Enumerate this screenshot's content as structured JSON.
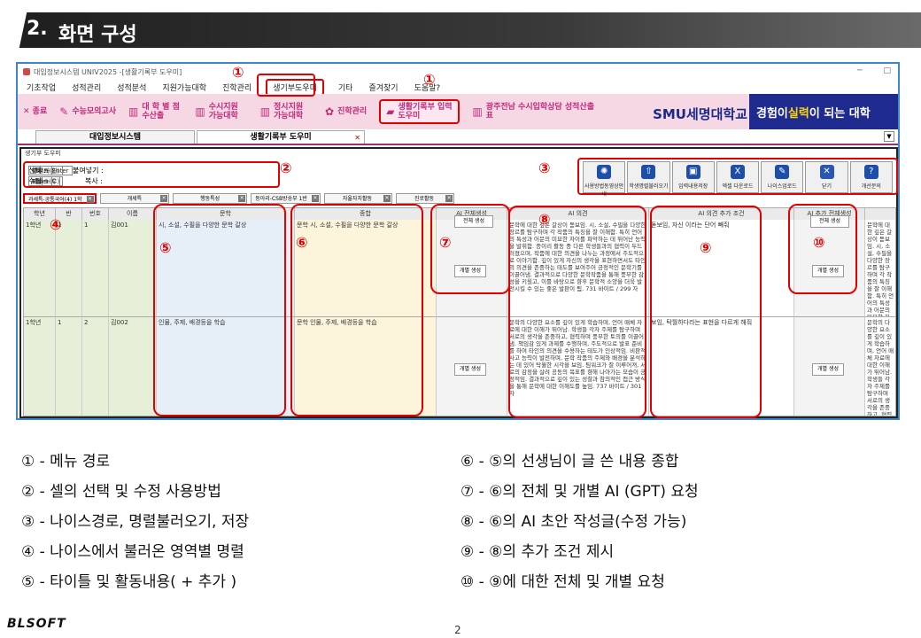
{
  "slide": {
    "number": "2.",
    "title": "화면 구성",
    "page": "2",
    "logo": "BLSOFT"
  },
  "window": {
    "title": "대입정보시스템 UNIV2025 -[생활기록부 도우미]",
    "min": "─",
    "max": "□"
  },
  "menu": [
    "기초작업",
    "성적관리",
    "성적분석",
    "지원가능대학",
    "진학관리",
    "생기부도우미",
    "기타",
    "즐겨찾기",
    "도움말?"
  ],
  "toolbar": {
    "items": [
      "✕ 종료",
      "수능모의고사",
      "대 학 별 점수산출",
      "수시지원 가능대학",
      "정시지원 가능대학",
      "진학관리"
    ],
    "highlight": "생활기록부 입력도우미",
    "extra": "광주전남 수시입학상담 성적산출표",
    "brand": "SMU세명대학교",
    "slogan_a": "경험이 ",
    "slogan_b": "실력",
    "slogan_c": "이 되는 대학"
  },
  "tabs": {
    "t1": "대입정보시스템",
    "t2": "생활기록부 도우미"
  },
  "inner": {
    "title": "생기부 도우미"
  },
  "help": {
    "sel": "선택 :",
    "sel_a": "방향키",
    "sel_b": "마우스(왼)",
    "edit": "수정 :",
    "edit_a": "Enter",
    "edit_b": "F2",
    "paste": "붙여넣기 :",
    "paste_v": "Ctrl + Enter",
    "copy": "복사 :",
    "copy_v": "Ctrl + C",
    "copy_b": "마우스(우)"
  },
  "buttons": [
    "사용방법동영상안내",
    "학생명렬불러오기",
    "입력내용저장",
    "엑셀 다운로드",
    "나이스업로드",
    "닫기",
    "개선문의"
  ],
  "subtabs": [
    "과세특-공통국어(4) 1학",
    "개세특",
    "행동특성",
    "동아리-CSB방송부 1반",
    "자율자치활동",
    "진로활동"
  ],
  "grid": {
    "headers": [
      "학년",
      "반",
      "번호",
      "이름",
      "문학",
      "종합",
      "AI 전체생성",
      "AI 의견",
      "AI 의견 추가 조건",
      "AI 추가 전체생성"
    ],
    "gen_all": "전체 생성",
    "gen_one": "개별 생성",
    "rows": [
      {
        "grade": "1학년",
        "cls": "1",
        "no": "1",
        "name": "김001",
        "lit": "시, 소설, 수필을 다양한 문학 갈상",
        "sum": "문학 시, 소설, 수필을 다양한 문학 갈상",
        "ai": "문학에 대한 깊은 갈상이 돋보임. 시, 소설, 수필을 다양한 장르를 탐구하며 각 작품의 특징을 잘 이해함. 특히 언어의 특성과 어문의 미묘한 차이를 파악하는 데 뛰어난 능력을 발휘함. 종이리 활동 중 다른 학생들과의 협력이 두드러졌으며, 작품에 대한 의견을 나누는 과정에서 주도적으로 이야기함. 깊이 있게 자신의 생각을 표현하면서도 타인의 의견을 존중하는 태도를 보여주어 긍정적인 문학기를 이끌어냄. 결과적으로 다양한 문학작품을 통해 풍부한 감성을 키웠고, 이를 바탕으로 향후 문학적 소양을 더욱 발전시킬 수 있는 좋은 발판이 됨. 731 바이트 / 299 자",
        "cond": "돋보임, 자신 이라는 단어 빼줘",
        "ext": "문학에 대한 깊은 갈상이 돋보임. 시, 소설, 수필을 다양한 장르를 탐구하며 각 작품의 특징을 잘 이해함. 특히 언어의 특성과 어문의 미묘한 차이를 파악하는 데 뛰어난 능력을 발휘함. 731 바이트 / 299 자"
      },
      {
        "grade": "1학년",
        "cls": "1",
        "no": "2",
        "name": "김002",
        "lit": "인물, 주제, 배경등을 학습",
        "sum": "문학 인물, 주제, 배경등을 학습",
        "ai": "문학의 다양한 요소를 깊이 있게 학습하며, 언어 매체 자료에 대한 이해가 뛰어남. 학생들 각자 주제를 탐구하며 서로의 생각을 존중하고, 협력하며 풍부한 토의를 이끌어냄. 책임감 있게 과제를 수행하며, 주도적으로 발표 준비를 하여 타인의 의견을 수용하는 태도가 인상적임. 비판적 사고 능력이 발전하며, 문학 작품의 주제와 배경을 분석하는 데 있어 탁월한 시각을 보임. 팀워크가 잘 이루어져, 서로의 감정을 살려 공동의 목표를 향해 나아가는 모습이 긍정적임. 결과적으로 깊이 있는 성찰과 참의적인 접근 방식을 통해 문학에 대한 이해도를 높임. 737 바이트 / 301 자",
        "cond": "보임, 탁월하다라는 표현을 다르게 해줘",
        "ext": "문학의 다양한 요소를 깊이 있게 학습하며, 언어 매체 자료에 대한 이해가 뛰어남. 학생들 각자 주제를 탐구하며 서로의 생각을 존중하고, 협력하며 풍부한 토의를 이끌어냄. 737 바이트 / 301 자"
      }
    ]
  },
  "markers": [
    "①",
    "①",
    "②",
    "③",
    "④",
    "⑤",
    "⑥",
    "⑦",
    "⑧",
    "⑨",
    "⑩"
  ],
  "legend_left": [
    "① - 메뉴 경로",
    "② - 셀의 선택 및 수정 사용방법",
    "③ - 나이스경로, 명렬불러오기, 저장",
    "④ - 나이스에서 불러온 영역별 명렬",
    "⑤ - 타이틀 및 활동내용( + 추가 )"
  ],
  "legend_right": [
    "⑥ - ⑤의 선생님이 글 쓴 내용 종합",
    "⑦ - ⑥의 전체 및 개별 AI (GPT) 요청",
    "⑧ - ⑥의 AI 초안 작성글(수정 가능)",
    "⑨ - ⑧의 추가 조건 제시",
    "⑩ - ⑨에 대한 전체 및 개별 요청"
  ]
}
